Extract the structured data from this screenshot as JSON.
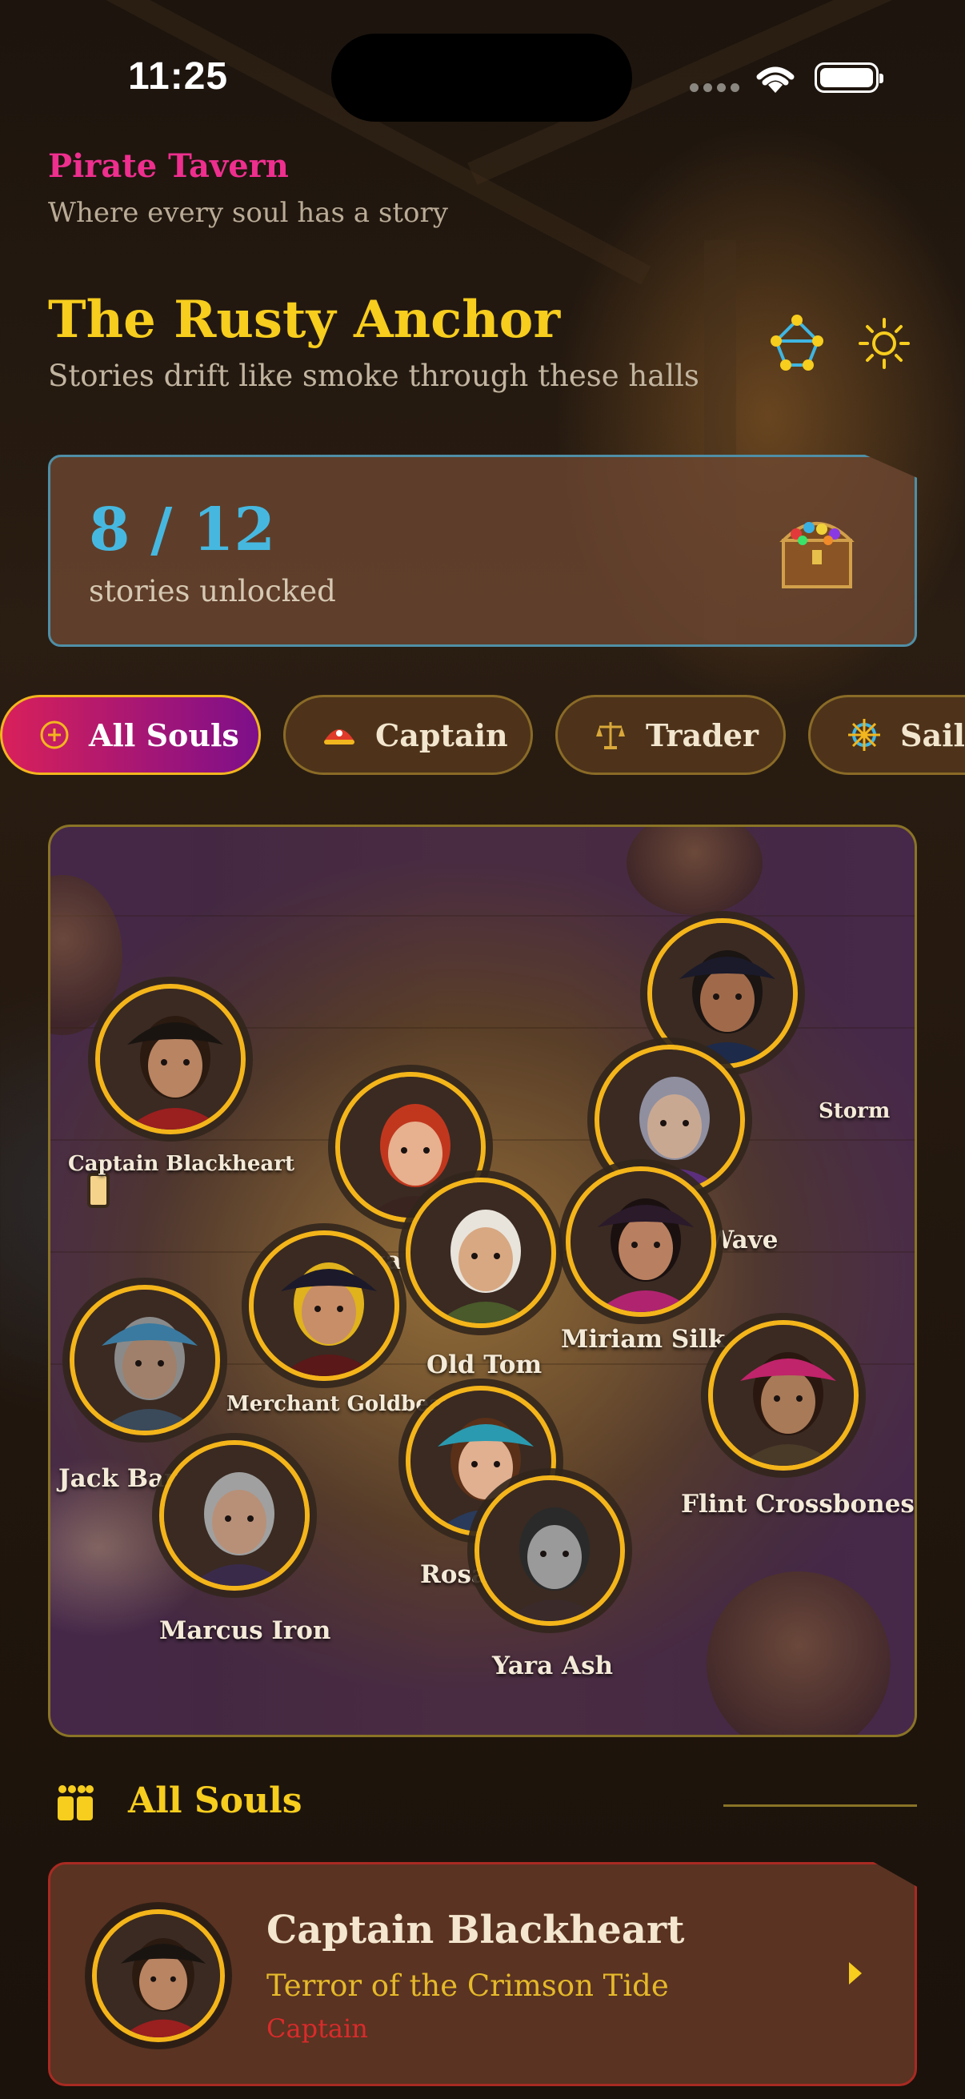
{
  "status_bar": {
    "time": "11:25"
  },
  "header": {
    "app_title": "Pirate Tavern",
    "app_subtitle": "Where every soul has a story",
    "venue_title": "The Rusty Anchor",
    "venue_subtitle": "Stories drift like smoke through these halls"
  },
  "progress": {
    "count": "8 / 12",
    "label": "stories unlocked"
  },
  "filters": [
    {
      "label": "All Souls",
      "icon": "plus-circle-icon",
      "active": true
    },
    {
      "label": "Captain",
      "icon": "pirate-hat-icon",
      "active": false
    },
    {
      "label": "Trader",
      "icon": "scales-icon",
      "active": false
    },
    {
      "label": "Sailor",
      "icon": "ship-wheel-icon",
      "active": false
    }
  ],
  "souls": [
    {
      "name": "Captain Blackheart",
      "skin": "#b98462",
      "hair": "#2a1a10",
      "cloth": "#9a1f1f",
      "hat": "#1a1410"
    },
    {
      "name": "Vega",
      "skin": "#e7b08e",
      "hair": "#c1371e",
      "cloth": "#3a2420",
      "hat": ""
    },
    {
      "name": "Storm",
      "skin": "#a06a4a",
      "hair": "#1a1412",
      "cloth": "#1d2a4a",
      "hat": "#1a1a2a"
    },
    {
      "name": "Madame Wave",
      "skin": "#c9a892",
      "hair": "#8f8fa0",
      "cloth": "#5b2f7d",
      "hat": ""
    },
    {
      "name": "Merchant Goldbeard",
      "skin": "#c88e68",
      "hair": "#e0b21c",
      "cloth": "#5a1818",
      "hat": "#1c1a2a"
    },
    {
      "name": "Old Tom",
      "skin": "#d8a882",
      "hair": "#e8e4dc",
      "cloth": "#4a5a2a",
      "hat": ""
    },
    {
      "name": "Miriam Silk",
      "skin": "#b88060",
      "hair": "#1a1010",
      "cloth": "#b0246f",
      "hat": "#2a1a2a"
    },
    {
      "name": "Jack Barnacle",
      "skin": "#a0806a",
      "hair": "#8a8a8a",
      "cloth": "#3a4a5a",
      "hat": "#3a7aa0"
    },
    {
      "name": "Marcus Iron",
      "skin": "#b89078",
      "hair": "#a0a0a0",
      "cloth": "#3a2a4a",
      "hat": ""
    },
    {
      "name": "Rosa Tide",
      "skin": "#e0b090",
      "hair": "#5a3018",
      "cloth": "#2a3a5a",
      "hat": "#2a9ab0"
    },
    {
      "name": "Yara Ash",
      "skin": "#9a9a9a",
      "hair": "#2a2a2a",
      "cloth": "#3a2a2a",
      "hat": ""
    },
    {
      "name": "Flint Crossbones",
      "skin": "#a87a58",
      "hair": "#2a1810",
      "cloth": "#4a3a28",
      "hat": "#c0246a"
    }
  ],
  "section": {
    "title": "All Souls"
  },
  "featured": {
    "name": "Captain Blackheart",
    "epithet": "Terror of the Crimson Tide",
    "role": "Captain"
  },
  "colors": {
    "accent_pink": "#ee2f8e",
    "accent_gold": "#f7cd1e",
    "accent_cyan": "#46b8e0",
    "ring_gold": "#f4b51a",
    "role_red": "#d92b2b"
  }
}
